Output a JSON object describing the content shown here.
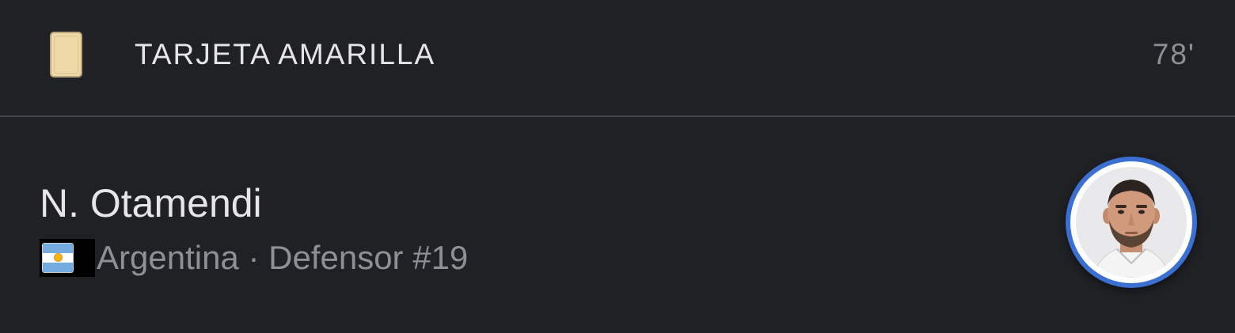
{
  "event": {
    "type_label": "TARJETA AMARILLA",
    "minute": "78'",
    "icon": "yellow-card-icon",
    "card_color": "#efd9a6"
  },
  "player": {
    "name": "N. Otamendi",
    "country_flag_icon": "argentina-flag-icon",
    "meta": "Argentina · Defensor #19",
    "avatar_ring_color": "#3b6fd1"
  }
}
